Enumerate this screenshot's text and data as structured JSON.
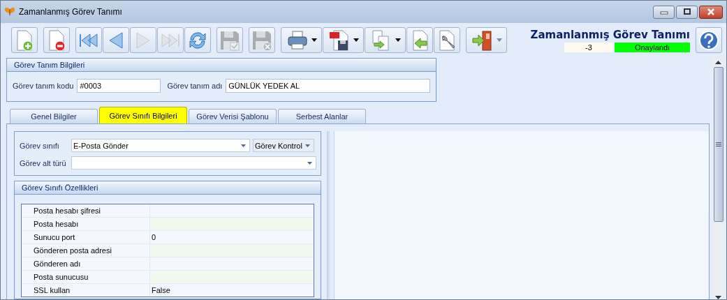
{
  "window": {
    "title": "Zamanlanmış Görev Tanımı"
  },
  "toolbar": [
    {
      "buttons": [
        {
          "kind": "new",
          "disabled": false,
          "dropdown": false
        }
      ]
    },
    {
      "buttons": [
        {
          "kind": "delete",
          "disabled": false,
          "dropdown": false
        }
      ]
    },
    {
      "buttons": [
        {
          "kind": "first",
          "disabled": false,
          "dropdown": false
        },
        {
          "kind": "prev",
          "disabled": false,
          "dropdown": false
        },
        {
          "kind": "next",
          "disabled": true,
          "dropdown": false
        },
        {
          "kind": "last",
          "disabled": true,
          "dropdown": false
        },
        {
          "kind": "refresh",
          "disabled": false,
          "dropdown": false
        }
      ]
    },
    {
      "buttons": [
        {
          "kind": "save",
          "disabled": true,
          "dropdown": false
        }
      ]
    },
    {
      "buttons": [
        {
          "kind": "cancel",
          "disabled": true,
          "dropdown": false
        }
      ]
    },
    {
      "buttons": [
        {
          "kind": "print",
          "disabled": false,
          "dropdown": true
        },
        {
          "kind": "pdf",
          "disabled": false,
          "dropdown": true
        },
        {
          "kind": "copy",
          "disabled": false,
          "dropdown": true
        },
        {
          "kind": "import",
          "disabled": false,
          "dropdown": false
        },
        {
          "kind": "tools",
          "disabled": false,
          "dropdown": false
        }
      ]
    },
    {
      "buttons": [
        {
          "kind": "exit",
          "disabled": false,
          "dropdown": true
        }
      ]
    }
  ],
  "header": {
    "title": "Zamanlanmış Görev Tanımı",
    "number": "-3",
    "status": {
      "text": "Onaylandı",
      "color": "#00ff00"
    }
  },
  "definition": {
    "title": "Görev Tanım Bilgileri",
    "code_label": "Görev tanım kodu",
    "code": "#0003",
    "name_label": "Görev tanım adı",
    "name": "GÜNLÜK YEDEK AL"
  },
  "tabs": [
    {
      "label": "Genel Bilgiler",
      "selected": false
    },
    {
      "label": "Görev Sınıfı Bilgileri",
      "selected": true
    },
    {
      "label": "Görev Verisi Şablonu",
      "selected": false
    },
    {
      "label": "Serbest Alanlar",
      "selected": false
    }
  ],
  "task_class": {
    "class_label": "Görev sınıfı",
    "class_value": "E-Posta Gönder",
    "control": "Görev Kontrol",
    "subtype_label": "Görev alt türü"
  },
  "properties": {
    "title": "Görev Sınıfı Özellikleri",
    "rows": [
      {
        "name": "Posta hesabı şifresi"
      },
      {
        "name": "Posta hesabı"
      },
      {
        "name": "Sunucu port",
        "value": "0"
      },
      {
        "name": "Gönderen posta adresi"
      },
      {
        "name": "Gönderen adı"
      },
      {
        "name": "Posta sunucusu"
      },
      {
        "name": "SSL kullan",
        "value": "False"
      }
    ]
  }
}
